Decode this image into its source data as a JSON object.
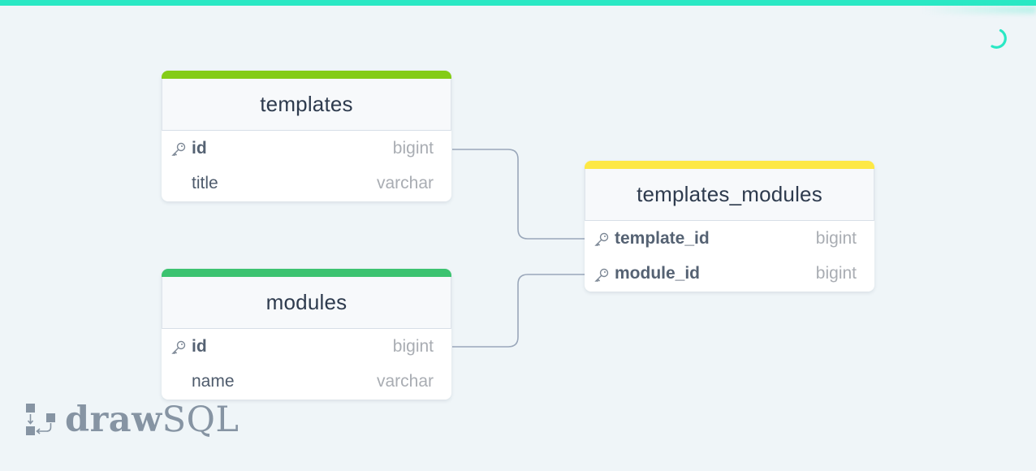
{
  "app": {
    "brand_bold": "draw",
    "brand_light": "SQL",
    "accent_color": "#2ae8c4",
    "status": "loading"
  },
  "tables": [
    {
      "name": "templates",
      "color": "#84cc16",
      "columns": [
        {
          "name": "id",
          "type": "bigint",
          "primary_key": true
        },
        {
          "name": "title",
          "type": "varchar",
          "primary_key": false
        }
      ]
    },
    {
      "name": "modules",
      "color": "#3cc370",
      "columns": [
        {
          "name": "id",
          "type": "bigint",
          "primary_key": true
        },
        {
          "name": "name",
          "type": "varchar",
          "primary_key": false
        }
      ]
    },
    {
      "name": "templates_modules",
      "color": "#fde845",
      "columns": [
        {
          "name": "template_id",
          "type": "bigint",
          "primary_key": true
        },
        {
          "name": "module_id",
          "type": "bigint",
          "primary_key": true
        }
      ]
    }
  ],
  "relations": [
    {
      "from": "templates.id",
      "to": "templates_modules.template_id"
    },
    {
      "from": "modules.id",
      "to": "templates_modules.module_id"
    }
  ]
}
